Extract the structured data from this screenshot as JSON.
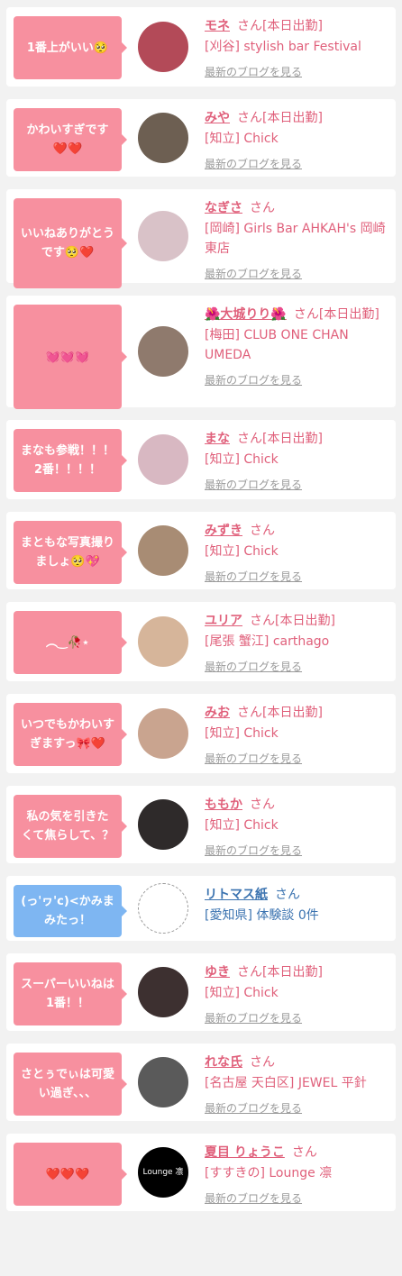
{
  "cards": [
    {
      "comment": "1番上がいい🥺",
      "name": "モネ",
      "honor": "さん[本日出勤]",
      "shop": "[刈谷] stylish bar Festival",
      "blog": "最新のブログを見る",
      "color": "pink",
      "avatar_bg": "#b34a58"
    },
    {
      "comment": "かわいすぎです❤️❤️",
      "name": "みや",
      "honor": "さん[本日出勤]",
      "shop": "[知立] Chick",
      "blog": "最新のブログを見る",
      "color": "pink",
      "avatar_bg": "#6d5f52"
    },
    {
      "comment": "いいねありがとうです🥺❤️",
      "name": "なぎさ",
      "honor": "さん",
      "shop": "[岡崎] Girls Bar AHKAH's 岡崎東店",
      "blog": "最新のブログを見る",
      "color": "pink",
      "avatar_bg": "#d9c2c8"
    },
    {
      "comment": "💓💓💓",
      "name": "🌺大城りり🌺",
      "honor": "さん[本日出勤]",
      "shop": "[梅田] CLUB ONE CHAN UMEDA",
      "blog": "最新のブログを見る",
      "color": "pink",
      "avatar_bg": "#8f7a6d"
    },
    {
      "comment": "まなも参戦！！！2番！！！！",
      "name": "まな",
      "honor": "さん[本日出勤]",
      "shop": "[知立] Chick",
      "blog": "最新のブログを見る",
      "color": "pink",
      "avatar_bg": "#d8b8c2"
    },
    {
      "comment": "まともな写真撮りましょ🥺💖",
      "name": "みずき",
      "honor": "さん",
      "shop": "[知立] Chick",
      "blog": "最新のブログを見る",
      "color": "pink",
      "avatar_bg": "#a88c74"
    },
    {
      "comment": "︵‿🥀⋆",
      "name": "ユリア",
      "honor": "さん[本日出勤]",
      "shop": "[尾張 蟹江] carthago",
      "blog": "最新のブログを見る",
      "color": "pink",
      "avatar_bg": "#d6b59a"
    },
    {
      "comment": "いつでもかわいすぎますっ🎀❤️",
      "name": "みお",
      "honor": "さん[本日出勤]",
      "shop": "[知立] Chick",
      "blog": "最新のブログを見る",
      "color": "pink",
      "avatar_bg": "#c9a48f"
    },
    {
      "comment": "私の気を引きたくて焦らして、？",
      "name": "ももか",
      "honor": "さん",
      "shop": "[知立] Chick",
      "blog": "最新のブログを見る",
      "color": "pink",
      "avatar_bg": "#2e2a2a"
    },
    {
      "comment": "(っ'ヮ'c)<かみまみたっ！",
      "name": "リトマス紙",
      "honor": "さん",
      "shop": "[愛知県] 体験談 0件",
      "blog": "",
      "color": "blue",
      "avatar_bg": "#ffffff"
    },
    {
      "comment": "スーパーいいねは1番！！",
      "name": "ゆき",
      "honor": "さん[本日出勤]",
      "shop": "[知立] Chick",
      "blog": "最新のブログを見る",
      "color": "pink",
      "avatar_bg": "#3d3030"
    },
    {
      "comment": "さとぅでぃは可愛い過ぎ、、、",
      "name": "れな氏",
      "honor": "さん",
      "shop": "[名古屋 天白区] JEWEL 平針",
      "blog": "最新のブログを見る",
      "color": "pink",
      "avatar_bg": "#5a5a5a"
    },
    {
      "comment": "❤️❤️❤️",
      "name": "夏目 りょうこ",
      "honor": "さん",
      "shop": "[すすきの] Lounge 凛",
      "blog": "最新のブログを見る",
      "color": "pink",
      "avatar_bg": "#000000",
      "avatar_text": "Lounge 凛"
    }
  ]
}
